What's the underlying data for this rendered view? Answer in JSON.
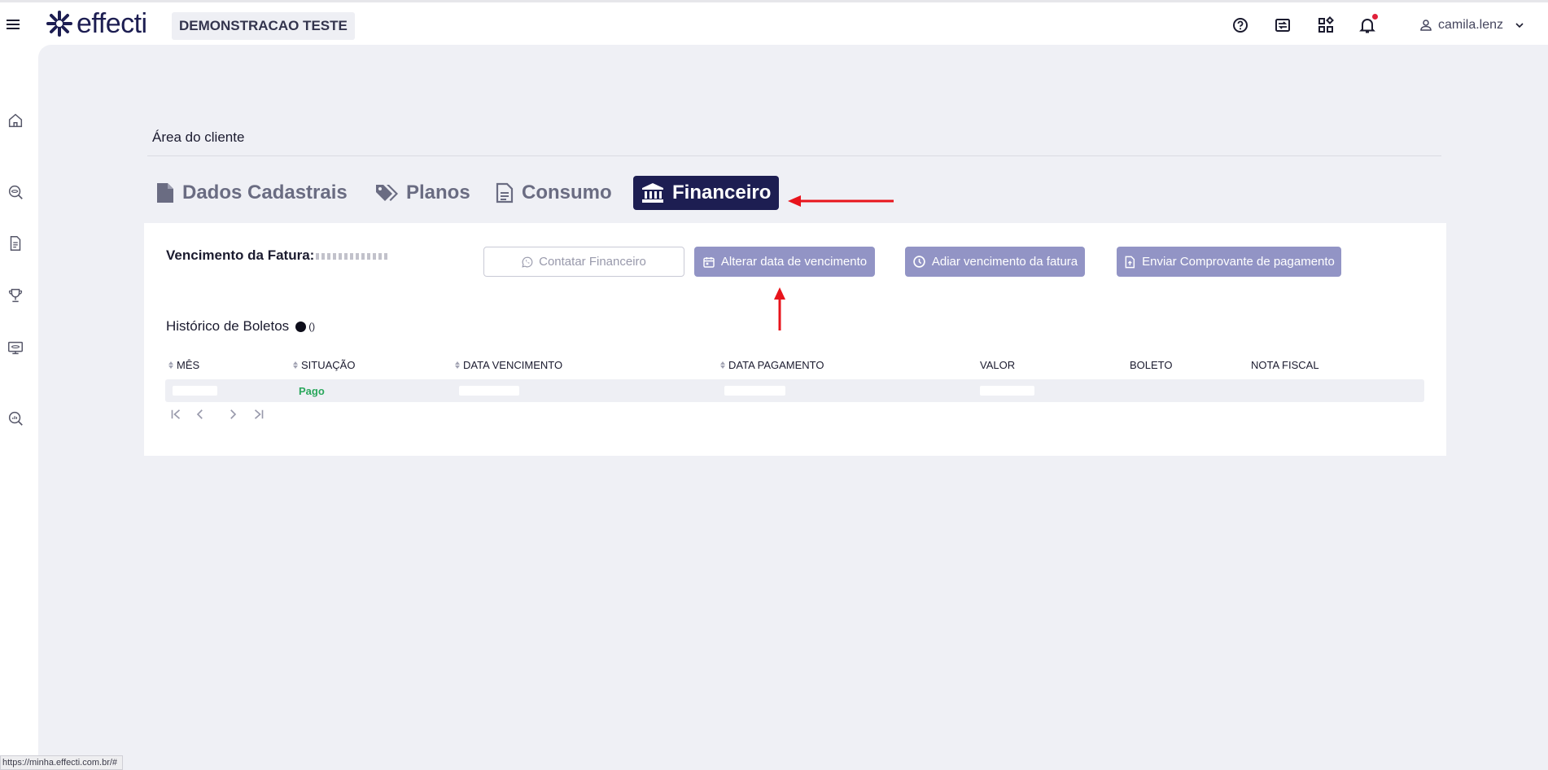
{
  "brand": {
    "logo_text": "effecti",
    "company_name": "DEMONSTRACAO TESTE"
  },
  "header": {
    "user_name": "camila.lenz",
    "icons": [
      "help-icon",
      "switch-icon",
      "apps-icon",
      "bell-icon",
      "user-icon",
      "chevron-down-icon"
    ]
  },
  "sidebar": {
    "icons": [
      "home-icon",
      "search-eye-icon",
      "document-icon",
      "trophy-icon",
      "monitor-icon",
      "analytics-icon"
    ]
  },
  "page": {
    "title": "Área do cliente"
  },
  "tabs": [
    {
      "label": "Dados Cadastrais",
      "icon": "file-icon",
      "active": false
    },
    {
      "label": "Planos",
      "icon": "tags-icon",
      "active": false
    },
    {
      "label": "Consumo",
      "icon": "document-icon",
      "active": false
    },
    {
      "label": "Financeiro",
      "icon": "bank-icon",
      "active": true
    }
  ],
  "finance": {
    "due_label": "Vencimento da Fatura:",
    "buttons": {
      "contact": "Contatar Financeiro",
      "change_due": "Alterar data de vencimento",
      "postpone": "Adiar vencimento da fatura",
      "send_receipt": "Enviar Comprovante de pagamento"
    },
    "history_title": "Histórico de Boletos",
    "history_count": "()"
  },
  "table": {
    "columns": [
      "MÊS",
      "SITUAÇÃO",
      "DATA VENCIMENTO",
      "DATA PAGAMENTO",
      "VALOR",
      "BOLETO",
      "NOTA FISCAL"
    ],
    "rows": [
      {
        "situacao": "Pago"
      }
    ]
  },
  "status_bar": {
    "url": "https://minha.effecti.com.br/#"
  },
  "colors": {
    "brand_navy": "#1d1e52",
    "button_purple": "#9294c5",
    "status_green": "#2aa75c",
    "annotation_red": "#e8141c",
    "notification_red": "#e0203a"
  }
}
